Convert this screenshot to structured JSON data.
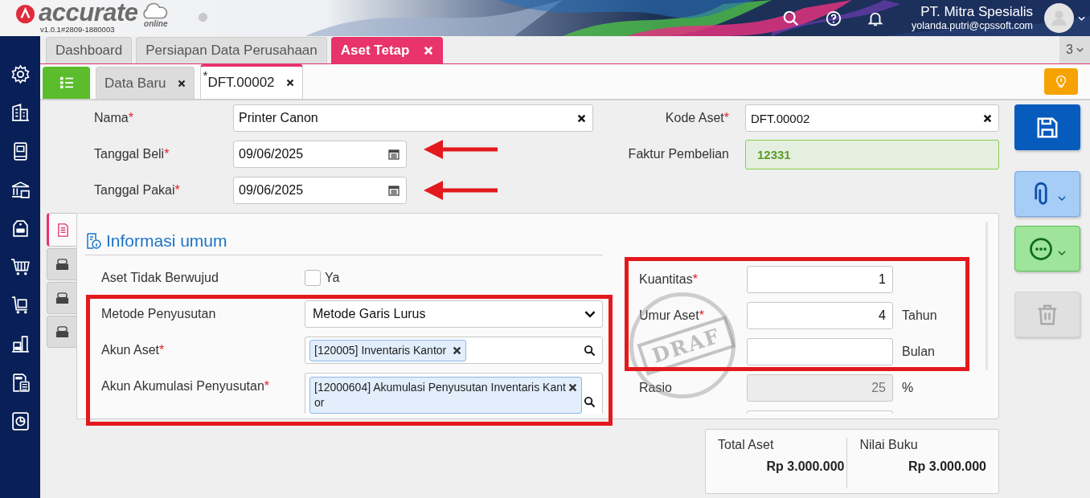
{
  "header": {
    "app_name": "accurate",
    "edition": "online",
    "version": "v1.0.1#2809-1880003",
    "company": "PT. Mitra Spesialis",
    "user_email": "yolanda.putri@cpssoft.com"
  },
  "module_tabs": [
    {
      "label": "Dashboard",
      "selected": false,
      "closable": false
    },
    {
      "label": "Persiapan Data Perusahaan",
      "selected": false,
      "closable": false
    },
    {
      "label": "Aset Tetap",
      "selected": true,
      "closable": true
    }
  ],
  "tab_count": "3",
  "doc_tabs": [
    {
      "label": "Data Baru",
      "selected": false
    },
    {
      "label": "DFT.00002",
      "selected": true,
      "modified_mark": "*"
    }
  ],
  "form_left": [
    {
      "kind": "text",
      "label": "Nama",
      "mark": "*",
      "value": "Printer Canon"
    },
    {
      "kind": "date",
      "label": "Tanggal Beli",
      "mark": "*",
      "value": "09/06/2025"
    },
    {
      "kind": "date",
      "label": "Tanggal Pakai",
      "mark": "*",
      "value": "09/06/2025"
    }
  ],
  "form_right": [
    {
      "kind": "text",
      "label": "Kode Aset",
      "mark": "*",
      "value": "DFT.00002"
    },
    {
      "kind": "linked",
      "label": "Faktur Pembelian",
      "value": "12331"
    }
  ],
  "actions": [
    {
      "kind": "save",
      "disabled": false
    },
    {
      "kind": "attach",
      "disabled": false
    },
    {
      "kind": "more",
      "disabled": false
    },
    {
      "kind": "delete",
      "disabled": true
    }
  ],
  "panel_tabs": [
    {
      "selected": true
    },
    {
      "selected": false
    },
    {
      "selected": false
    },
    {
      "selected": false
    }
  ],
  "panel_title": "Informasi umum",
  "panel_left": [
    {
      "kind": "checkbox",
      "label": "Aset Tidak Berwujud",
      "option": "Ya",
      "checked": false
    },
    {
      "kind": "select",
      "label": "Metode Penyusutan",
      "value": "Metode Garis Lurus"
    },
    {
      "kind": "tags",
      "label": "Akun Aset",
      "mark": "*",
      "tag": "[120005] Inventaris Kantor"
    },
    {
      "kind": "tags",
      "label": "Akun Akumulasi Penyusutan",
      "mark": "*",
      "tag": "[12000604] Akumulasi Penyusutan Inventaris Kantor"
    }
  ],
  "panel_right": [
    {
      "kind": "number",
      "label": "Kuantitas",
      "mark": "*",
      "value": "1"
    },
    {
      "kind": "number",
      "label": "Umur Aset",
      "mark": "*",
      "value": "4",
      "unit": "Tahun"
    },
    {
      "kind": "number",
      "unit": "Bulan"
    },
    {
      "kind": "readonly",
      "label": "Rasio",
      "value": "25",
      "unit": "%"
    },
    {
      "kind": "number"
    }
  ],
  "stamp": "DRAF",
  "summary": [
    {
      "label": "Total Aset",
      "value": "Rp 3.000.000"
    },
    {
      "label": "Nilai Buku",
      "value": "Rp 3.000.000"
    }
  ],
  "annotations": [
    {
      "kind": "arrow"
    },
    {
      "kind": "arrow"
    },
    {
      "kind": "box"
    },
    {
      "kind": "box"
    }
  ]
}
